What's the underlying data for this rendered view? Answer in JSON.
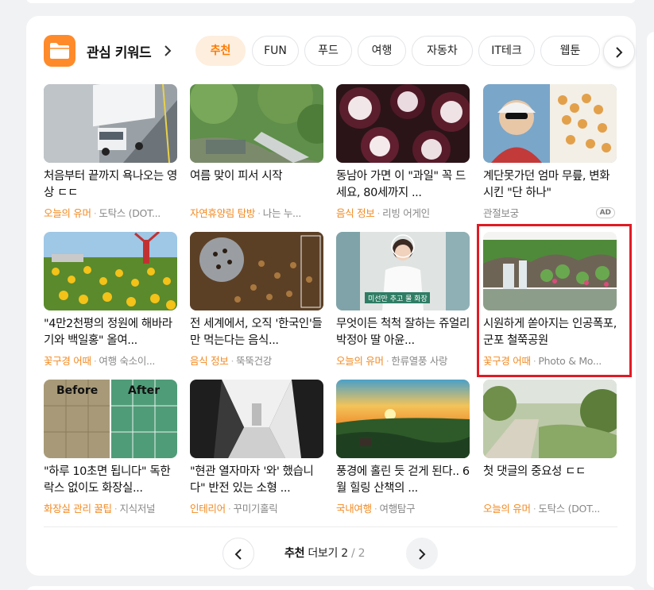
{
  "section": {
    "title": "관심 키워드",
    "chips": [
      {
        "label": "추천",
        "active": true
      },
      {
        "label": "FUN"
      },
      {
        "label": "푸드"
      },
      {
        "label": "여행"
      },
      {
        "label": "자동차"
      },
      {
        "label": "IT테크"
      },
      {
        "label": "웹툰"
      }
    ]
  },
  "items": [
    {
      "title": "처음부터 끝까지 욕나오는 영상 ㄷㄷ",
      "category": "오늘의 유머",
      "source": "도탁스 (DOT..."
    },
    {
      "title": "여름 맞이 피서 시작",
      "category": "자연휴양림 탐방",
      "source": "나는 누..."
    },
    {
      "title": "동남아 가면 이 \"과일\" 꼭 드세요, 80세까지 ...",
      "category": "음식 정보",
      "source": "리빙 어게인"
    },
    {
      "title": "계단못가던 엄마 무릎, 변화시킨 \"단 하나\"",
      "category": "",
      "source": "관절보궁",
      "ad": "AD"
    },
    {
      "title": "\"4만2천평의 정원에 해바라기와 백일홍\" 올여...",
      "category": "꽃구경 어때",
      "source": "여행 숙소이..."
    },
    {
      "title": "전 세계에서, 오직 '한국인'들만 먹는다는 음식...",
      "category": "음식 정보",
      "source": "뚝뚝건강"
    },
    {
      "title": "무엇이든 척척 잘하는 쥬얼리 박정아 딸 아윤...",
      "category": "오늘의 유머",
      "source": "한류열풍 사랑"
    },
    {
      "title": "시원하게 쏟아지는 인공폭포, 군포 철쭉공원",
      "category": "꽃구경 어때",
      "source": "Photo & Mo..."
    },
    {
      "title": "\"하루 10초면 됩니다\" 독한 락스 없이도 화장실...",
      "category": "화장실 관리 꿀팁",
      "source": "지식저널"
    },
    {
      "title": "\"현관 열자마자 '와' 했습니다\" 반전 있는 소형 ...",
      "category": "인테리어",
      "source": "꾸미기홀릭"
    },
    {
      "title": "풍경에 홀린 듯 걷게 된다.. 6월 힐링 산책의 ...",
      "category": "국내여행",
      "source": "여행탐구"
    },
    {
      "title": "첫 댓글의 중요성 ㄷㄷ",
      "category": "오늘의 유머",
      "source": "도탁스 (DOT..."
    }
  ],
  "thumb_captions": {
    "before": "Before",
    "after": "After",
    "tv": "미선만 추고 물 화장"
  },
  "pager": {
    "label": "추천",
    "more": "더보기",
    "current": "2",
    "sep": "/",
    "total": "2"
  },
  "colors": {
    "accent": "#ff7a00",
    "category": "#f28a22",
    "highlight": "#e01b24"
  }
}
